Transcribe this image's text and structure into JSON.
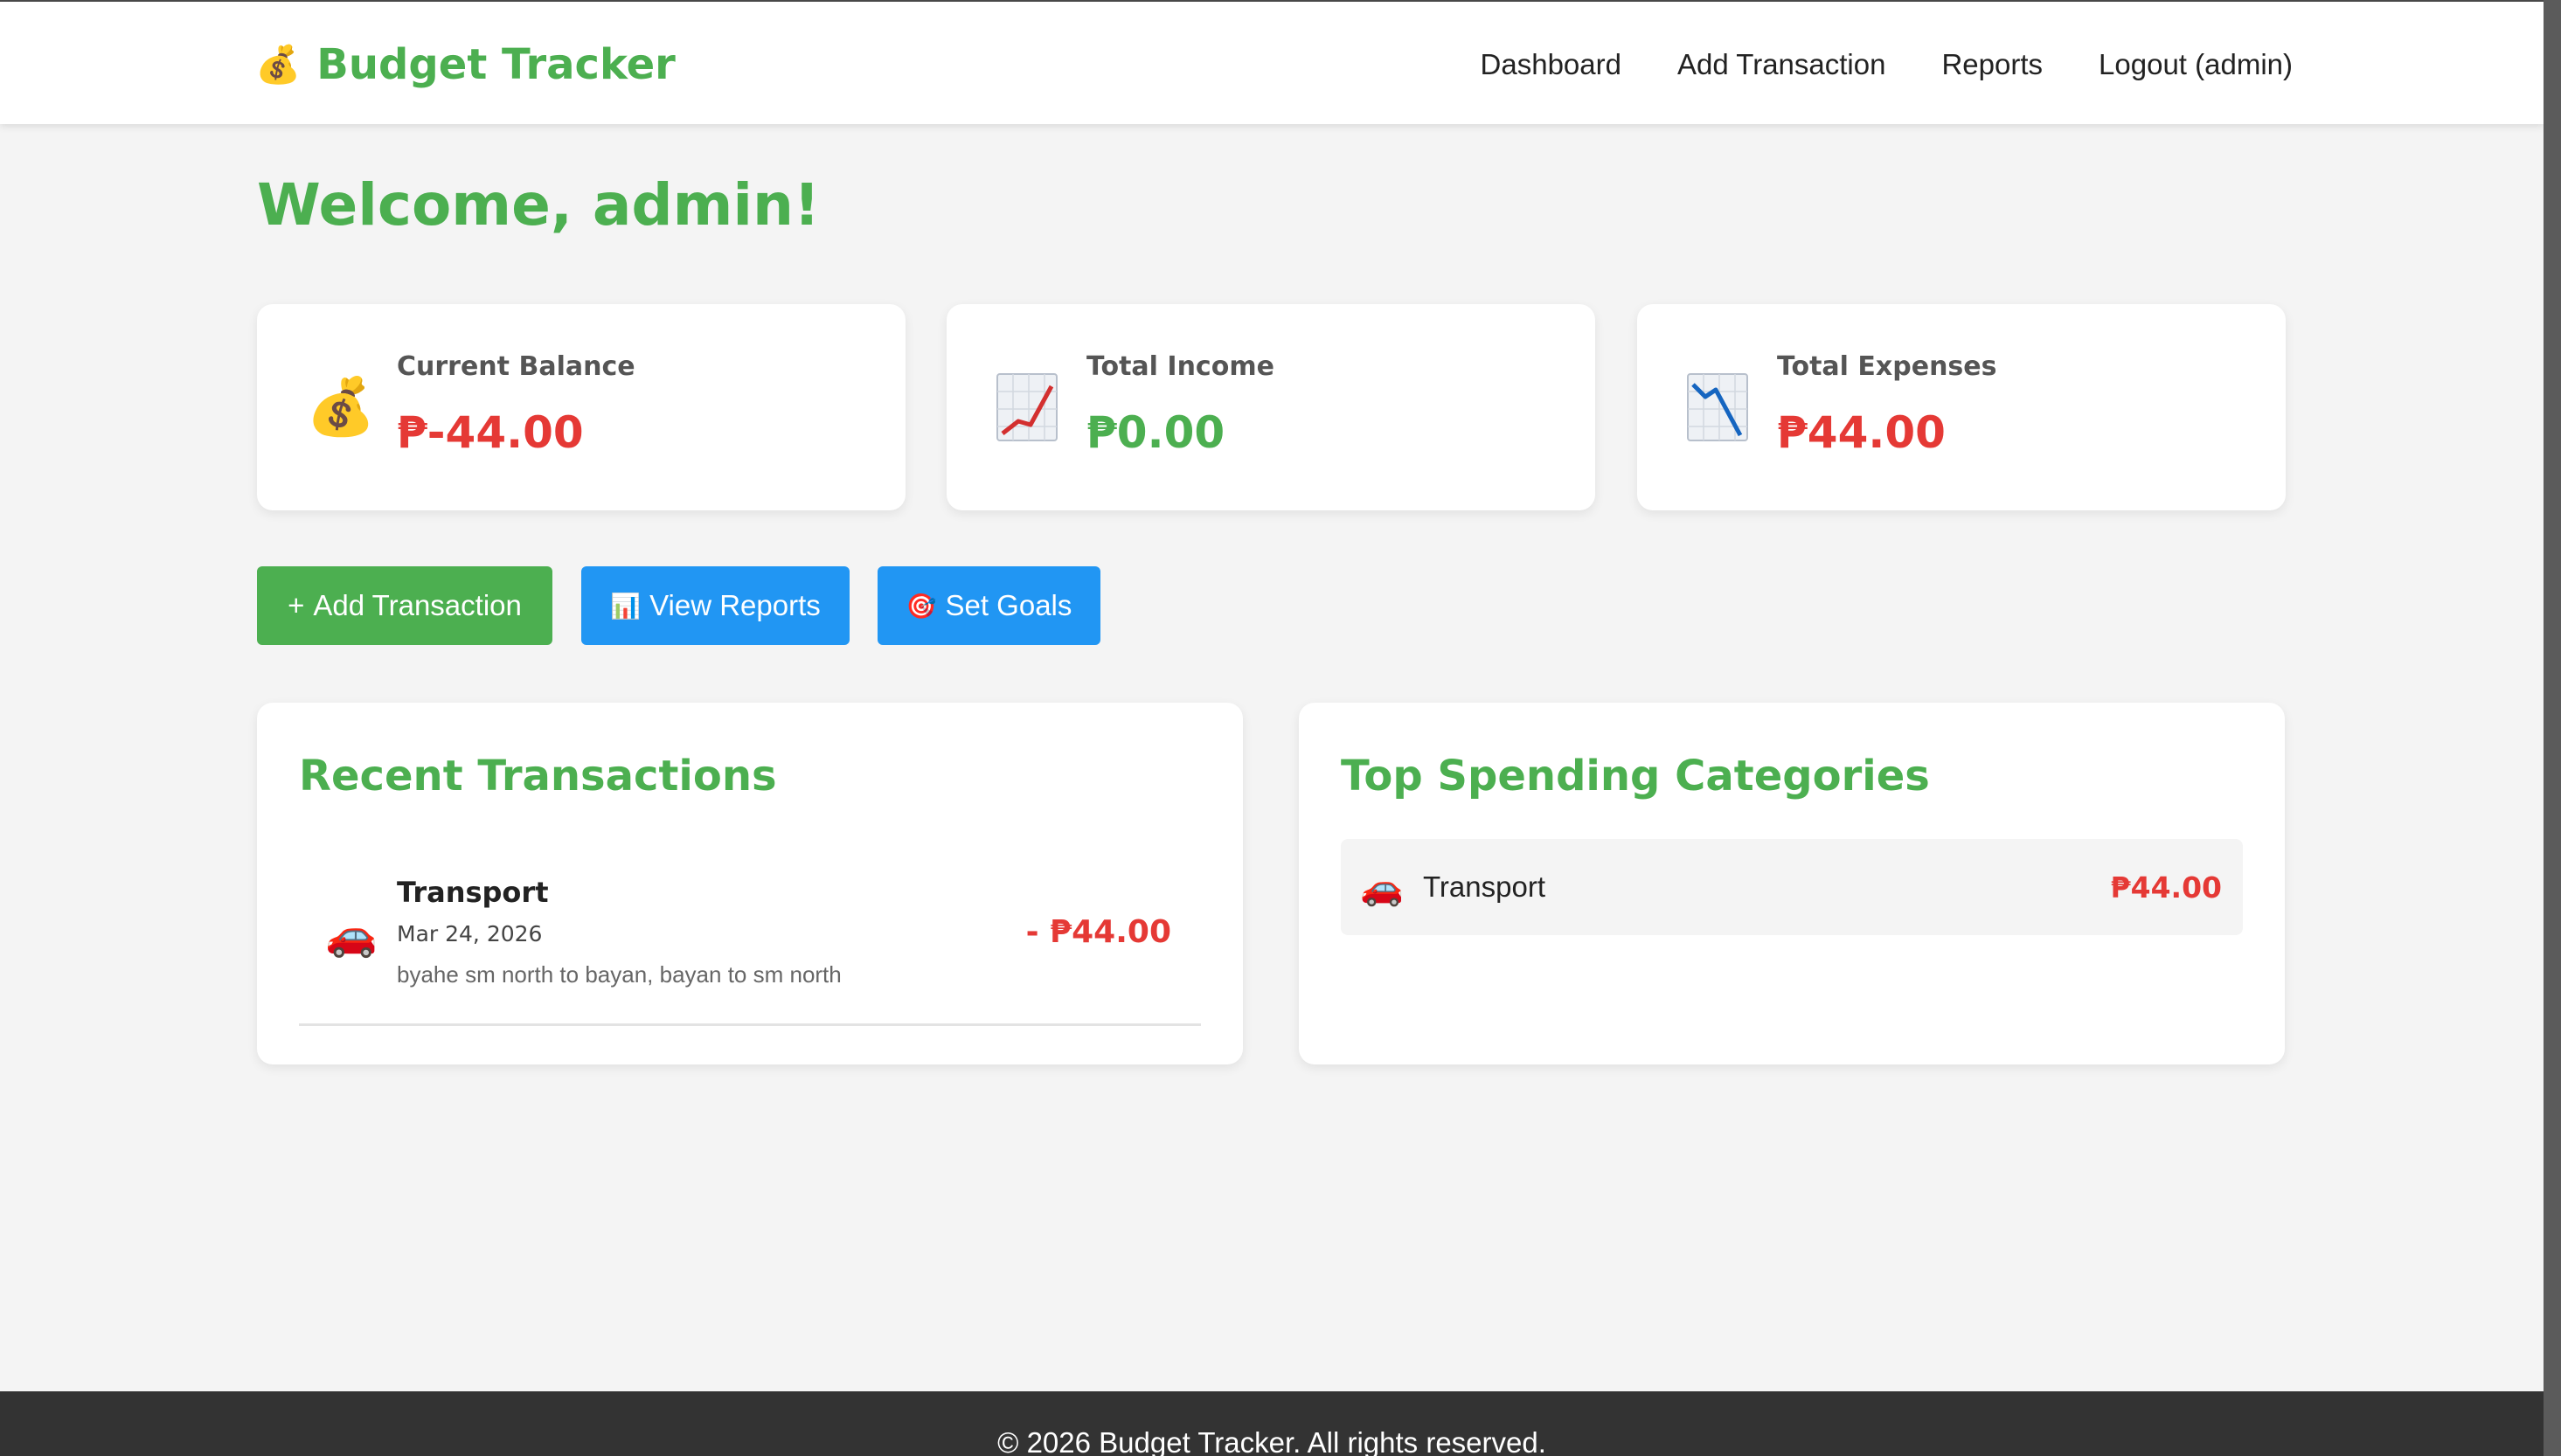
{
  "header": {
    "brand_icon": "money-bag-icon",
    "brand_title": "Budget Tracker",
    "nav": [
      "Dashboard",
      "Add Transaction",
      "Reports",
      "Logout (admin)"
    ]
  },
  "welcome": "Welcome, admin!",
  "stats": [
    {
      "label": "Current Balance",
      "value": "₱-44.00",
      "icon": "money-bag-icon",
      "color": "#e53935"
    },
    {
      "label": "Total Income",
      "value": "₱0.00",
      "icon": "chart-increasing-icon",
      "color": "#4caf50"
    },
    {
      "label": "Total Expenses",
      "value": "₱44.00",
      "icon": "chart-decreasing-icon",
      "color": "#e53935"
    }
  ],
  "actions": {
    "add": {
      "glyph": "+",
      "label": "Add Transaction"
    },
    "reports": {
      "glyph": "📊",
      "label": "View Reports"
    },
    "goals": {
      "glyph": "🎯",
      "label": "Set Goals"
    }
  },
  "recent": {
    "title": "Recent Transactions",
    "items": [
      {
        "icon": "car-icon",
        "category": "Transport",
        "date": "Mar 24, 2026",
        "description": "byahe sm north to bayan, bayan to sm north",
        "amount": "- ₱44.00"
      }
    ]
  },
  "top_categories": {
    "title": "Top Spending Categories",
    "items": [
      {
        "icon": "car-icon",
        "name": "Transport",
        "amount": "₱44.00"
      }
    ]
  },
  "footer": "© 2026 Budget Tracker. All rights reserved.",
  "colors": {
    "accent": "#4caf50",
    "primary": "#2196f3",
    "expense": "#e53935",
    "footer": "#333333"
  }
}
